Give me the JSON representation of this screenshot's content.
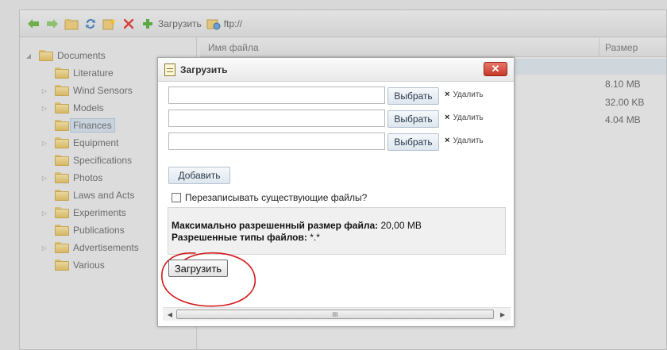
{
  "toolbar": {
    "upload_label": "Загрузить",
    "ftp_label": "ftp://"
  },
  "tree": {
    "items": [
      {
        "label": "Documents",
        "expandable": true,
        "expanded": true
      },
      {
        "label": "Literature",
        "expandable": false
      },
      {
        "label": "Wind Sensors",
        "expandable": true
      },
      {
        "label": "Models",
        "expandable": true
      },
      {
        "label": "Finances",
        "expandable": false,
        "selected": true
      },
      {
        "label": "Equipment",
        "expandable": true
      },
      {
        "label": "Specifications",
        "expandable": false
      },
      {
        "label": "Photos",
        "expandable": true
      },
      {
        "label": "Laws and Acts",
        "expandable": false
      },
      {
        "label": "Experiments",
        "expandable": true
      },
      {
        "label": "Publications",
        "expandable": false
      },
      {
        "label": "Advertisements",
        "expandable": true
      },
      {
        "label": "Various",
        "expandable": false
      }
    ]
  },
  "list": {
    "col_name": "Имя файла",
    "col_size": "Размер",
    "sizes": [
      "8.10 MB",
      "32.00 KB",
      "4.04 MB"
    ]
  },
  "dialog": {
    "title": "Загрузить",
    "choose_label": "Выбрать",
    "delete_label": "Удалить",
    "add_label": "Добавить",
    "overwrite_label": "Перезаписывать существующие файлы?",
    "max_size_label": "Максимально разрешенный размер файла:",
    "max_size_value": "20,00 MB",
    "types_label": "Разрешенные типы файлов:",
    "types_value": "*.*",
    "upload_label": "Загрузить",
    "scroll_grip": "III"
  },
  "colors": {
    "annotation": "#d21a1a",
    "close": "#c8392a"
  }
}
